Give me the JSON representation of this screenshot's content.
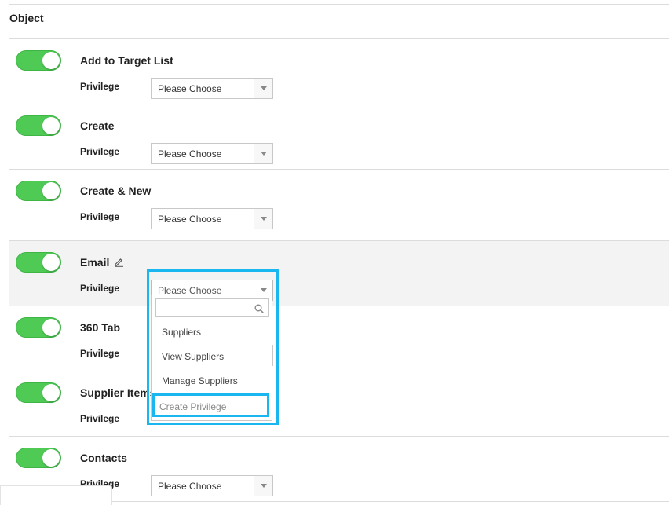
{
  "section": {
    "title": "Object"
  },
  "privilege_label": "Privilege",
  "rows": [
    {
      "title": "Add to Target List",
      "enabled": true,
      "select_value": "Please Choose"
    },
    {
      "title": "Create",
      "enabled": true,
      "select_value": "Please Choose"
    },
    {
      "title": "Create & New",
      "enabled": true,
      "select_value": "Please Choose"
    },
    {
      "title": "Email",
      "enabled": true,
      "select_value": "Please Choose",
      "editable": true
    },
    {
      "title": "360 Tab",
      "enabled": true,
      "select_value": ""
    },
    {
      "title": "Supplier Items",
      "enabled": true,
      "select_value": ""
    },
    {
      "title": "Contacts",
      "enabled": true,
      "select_value": "Please Choose"
    }
  ],
  "dropdown": {
    "search_value": "",
    "options": [
      "Suppliers",
      "View Suppliers",
      "Manage Suppliers",
      "Create Privilege"
    ]
  },
  "colors": {
    "toggle_on": "#4fcb55",
    "highlight": "#1ab6ef",
    "row_highlight": "#f3f3f3"
  }
}
